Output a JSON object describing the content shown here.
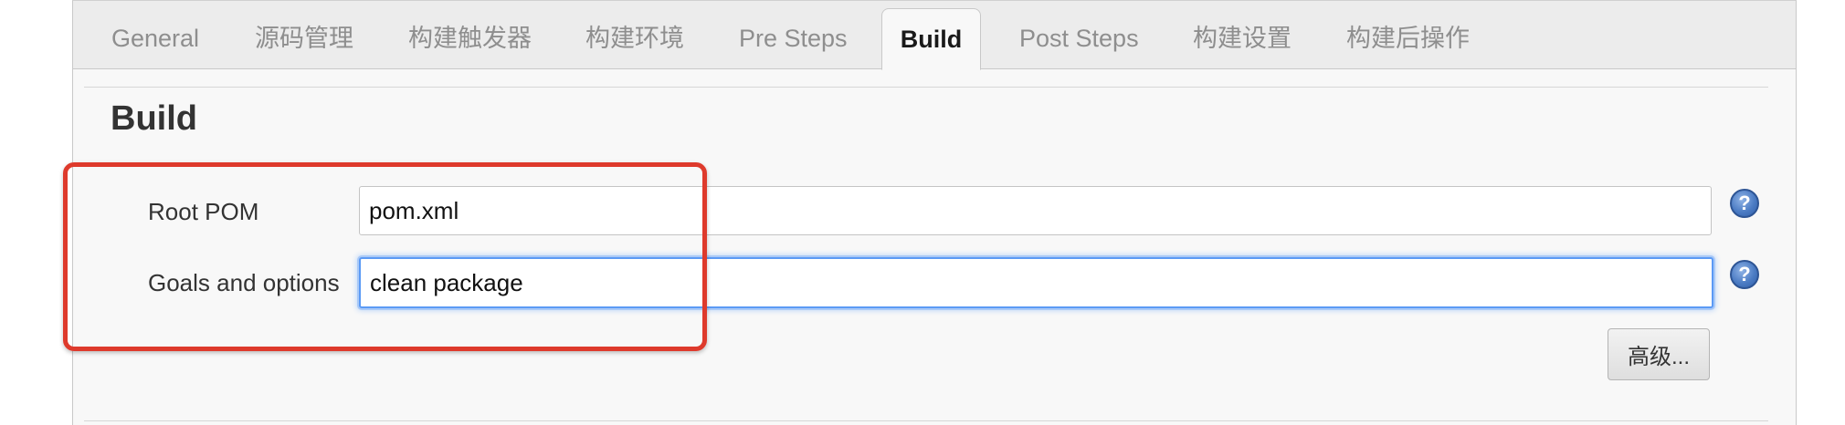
{
  "tabs": [
    {
      "label": "General",
      "active": false
    },
    {
      "label": "源码管理",
      "active": false
    },
    {
      "label": "构建触发器",
      "active": false
    },
    {
      "label": "构建环境",
      "active": false
    },
    {
      "label": "Pre Steps",
      "active": false
    },
    {
      "label": "Build",
      "active": true
    },
    {
      "label": "Post Steps",
      "active": false
    },
    {
      "label": "构建设置",
      "active": false
    },
    {
      "label": "构建后操作",
      "active": false
    }
  ],
  "section": {
    "title": "Build"
  },
  "fields": {
    "root_pom": {
      "label": "Root POM",
      "value": "pom.xml",
      "help": "?"
    },
    "goals": {
      "label": "Goals and options",
      "value": "clean package",
      "help": "?"
    }
  },
  "advanced_button": {
    "label": "高级..."
  },
  "colors": {
    "highlight": "#de3a2c",
    "focus": "#5b9af5",
    "help_icon": "#4c7cc4"
  },
  "icons": {
    "help": "help-icon"
  }
}
